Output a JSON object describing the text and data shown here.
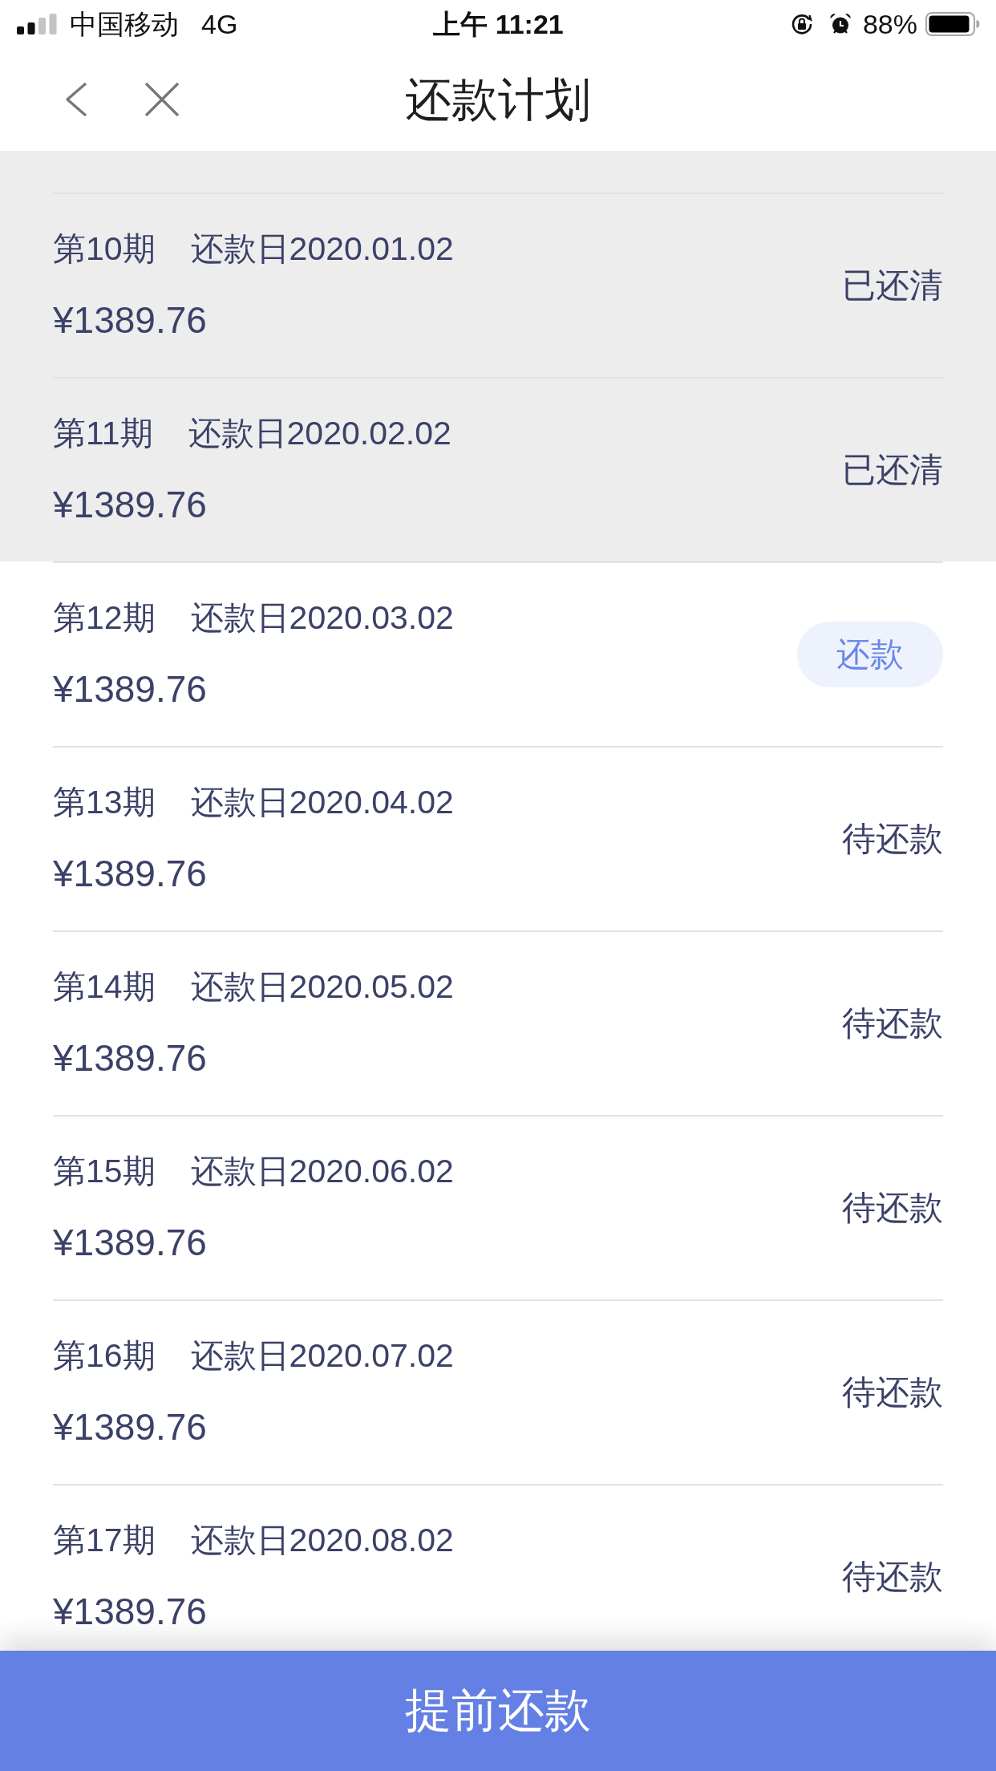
{
  "status_bar": {
    "carrier": "中国移动",
    "network": "4G",
    "time": "上午 11:21",
    "battery_percent": "88%"
  },
  "nav_bar": {
    "title": "还款计划"
  },
  "installments": [
    {
      "kind": "paid",
      "period": "第10期",
      "due_date": "还款日2020.01.02",
      "amount": "¥1389.76",
      "status": "已还清"
    },
    {
      "kind": "paid",
      "period": "第11期",
      "due_date": "还款日2020.02.02",
      "amount": "¥1389.76",
      "status": "已还清"
    },
    {
      "kind": "due",
      "period": "第12期",
      "due_date": "还款日2020.03.02",
      "amount": "¥1389.76",
      "status": "还款"
    },
    {
      "kind": "pending",
      "period": "第13期",
      "due_date": "还款日2020.04.02",
      "amount": "¥1389.76",
      "status": "待还款"
    },
    {
      "kind": "pending",
      "period": "第14期",
      "due_date": "还款日2020.05.02",
      "amount": "¥1389.76",
      "status": "待还款"
    },
    {
      "kind": "pending",
      "period": "第15期",
      "due_date": "还款日2020.06.02",
      "amount": "¥1389.76",
      "status": "待还款"
    },
    {
      "kind": "pending",
      "period": "第16期",
      "due_date": "还款日2020.07.02",
      "amount": "¥1389.76",
      "status": "待还款"
    },
    {
      "kind": "pending",
      "period": "第17期",
      "due_date": "还款日2020.08.02",
      "amount": "¥1389.76",
      "status": "待还款"
    }
  ],
  "footer_button": {
    "label": "提前还款"
  }
}
